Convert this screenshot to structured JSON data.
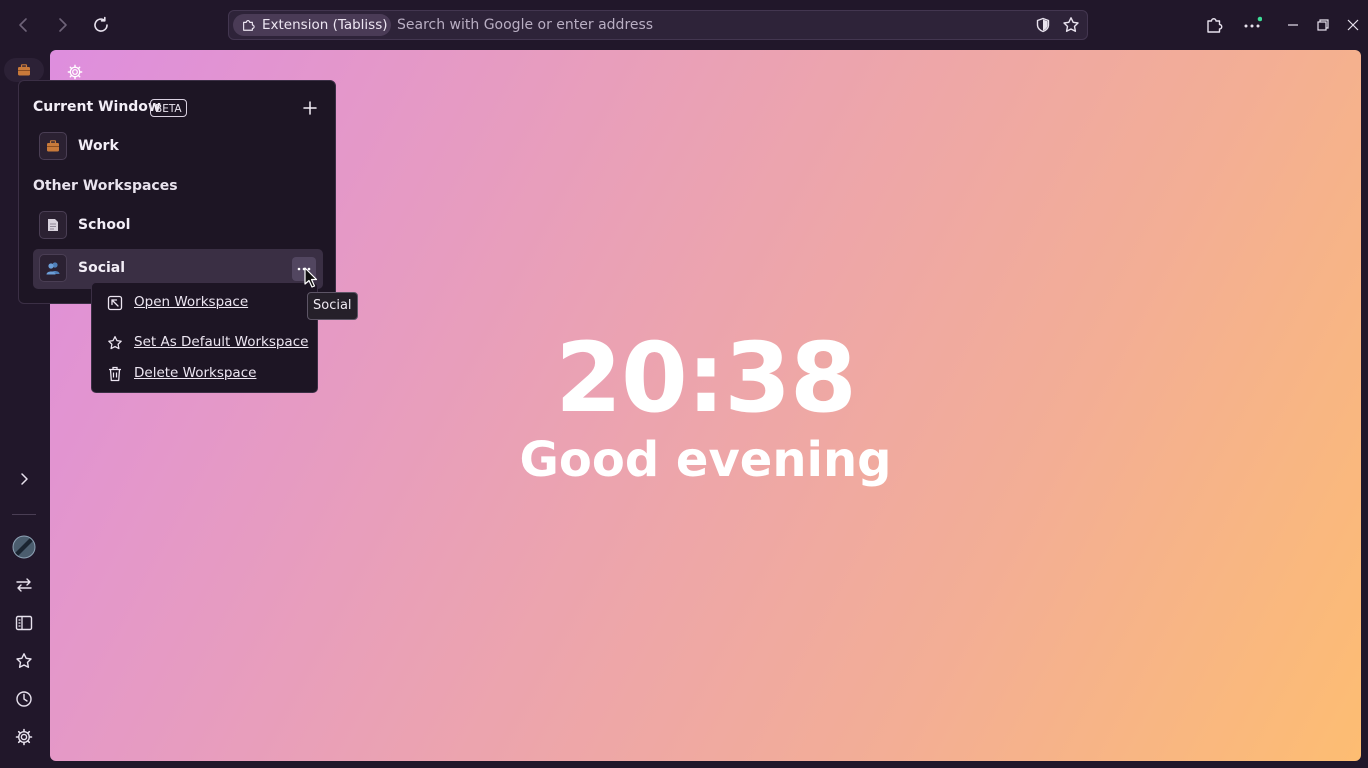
{
  "toolbar": {
    "extension_label": "Extension (Tabliss)",
    "url_placeholder": "Search with Google or enter address"
  },
  "clock": {
    "time": "20:38",
    "greeting": "Good evening"
  },
  "workspaces": {
    "current_title": "Current Window",
    "beta_badge": "BETA",
    "current": {
      "label": "Work",
      "icon": "briefcase-icon"
    },
    "other_title": "Other Workspaces",
    "others": [
      {
        "label": "School",
        "icon": "document-icon"
      },
      {
        "label": "Social",
        "icon": "people-icon"
      }
    ]
  },
  "context_menu": {
    "items": [
      {
        "label": "Open Workspace",
        "icon": "open-workspace-icon"
      },
      {
        "label": "Set As Default Workspace",
        "icon": "star-icon"
      },
      {
        "label": "Delete Workspace",
        "icon": "trash-icon"
      }
    ]
  },
  "tooltip": "Social",
  "colors": {
    "frame": "#21172a",
    "panel": "#1d1524",
    "gradient": [
      "#de8ede",
      "#eaa1b5",
      "#f3ae95",
      "#fdbd72"
    ],
    "notification_dot": "#3ddc97"
  }
}
